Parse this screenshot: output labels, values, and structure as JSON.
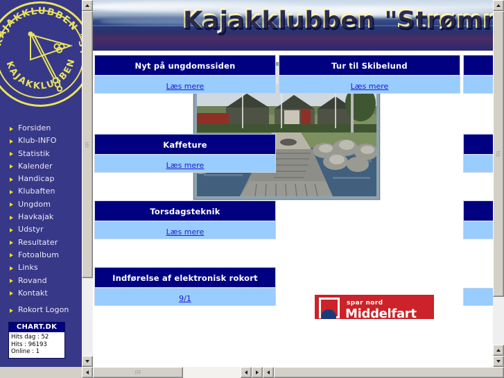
{
  "colors": {
    "sidebar_bg": "#383889",
    "logo_yellow": "#e8e45c",
    "header_navy": "#000080",
    "cell_lightblue": "#99ccff",
    "link_blue": "#1a1ad0",
    "sponsor_red": "#cc2229",
    "banner_text": "#fbf3b4"
  },
  "sidebar": {
    "logo": {
      "icon": "club-crest-icon",
      "ring_text_top": "KAJAKKLUBBEN \"STRØMMEN\"",
      "ring_text_bottom": "KAJAKKLUBBEN · STRØMMEN"
    },
    "items": [
      {
        "label": "Forsiden",
        "icon": "bullet-arrow-icon"
      },
      {
        "label": "Klub-INFO",
        "icon": "bullet-arrow-icon"
      },
      {
        "label": "Statistik",
        "icon": "bullet-arrow-icon"
      },
      {
        "label": "Kalender",
        "icon": "bullet-arrow-icon"
      },
      {
        "label": "Handicap",
        "icon": "bullet-arrow-icon"
      },
      {
        "label": "Klubaften",
        "icon": "bullet-arrow-icon"
      },
      {
        "label": "Ungdom",
        "icon": "bullet-arrow-icon"
      },
      {
        "label": "Havkajak",
        "icon": "bullet-arrow-icon"
      },
      {
        "label": "Udstyr",
        "icon": "bullet-arrow-icon"
      },
      {
        "label": "Resultater",
        "icon": "bullet-arrow-icon"
      },
      {
        "label": "Fotoalbum",
        "icon": "bullet-arrow-icon"
      },
      {
        "label": "Links",
        "icon": "bullet-arrow-icon"
      },
      {
        "label": "Rovand",
        "icon": "bullet-arrow-icon"
      },
      {
        "label": "Kontakt",
        "icon": "bullet-arrow-icon"
      },
      {
        "label": "Rokort Logon",
        "icon": "bullet-arrow-icon"
      }
    ],
    "counter": {
      "title": "CHART.DK",
      "rows": [
        "Hits dag : 52",
        "Hits : 96193",
        "Online : 1"
      ]
    }
  },
  "banner": {
    "title": "Kajakklubben \"Strømmen\""
  },
  "main": {
    "sections": [
      {
        "heading": "Nyt på ungdomssiden",
        "link": "Læs mere"
      },
      {
        "heading": "Tur til Skibelund",
        "link": "Læs mere"
      },
      {
        "heading": "Kaffeture",
        "link": "Læs mere"
      },
      {
        "heading": "Torsdagsteknik",
        "link": "Læs mere"
      },
      {
        "heading": "Indførelse af elektronisk rokort",
        "link": "9/1"
      }
    ],
    "kayak_graphic": "kayak-with-paddlers-icon",
    "photo": {
      "name": "wooden-jetty-photo",
      "alt": "Træbro ud i vandet med klubhuse og flagstænger i baggrunden"
    },
    "sponsor": {
      "line1": "spar nord",
      "line2": "Middelfart"
    }
  },
  "scrollbars": {
    "inner_vertical": {
      "up": "scroll-up-arrow",
      "down": "scroll-down-arrow"
    },
    "inner_horizontal": {
      "left": "scroll-left-arrow",
      "right": "scroll-right-arrow"
    },
    "outer_vertical": {
      "up": "scroll-up-arrow",
      "down": "scroll-down-arrow"
    },
    "outer_horizontal": {
      "left": "scroll-left-arrow"
    }
  }
}
